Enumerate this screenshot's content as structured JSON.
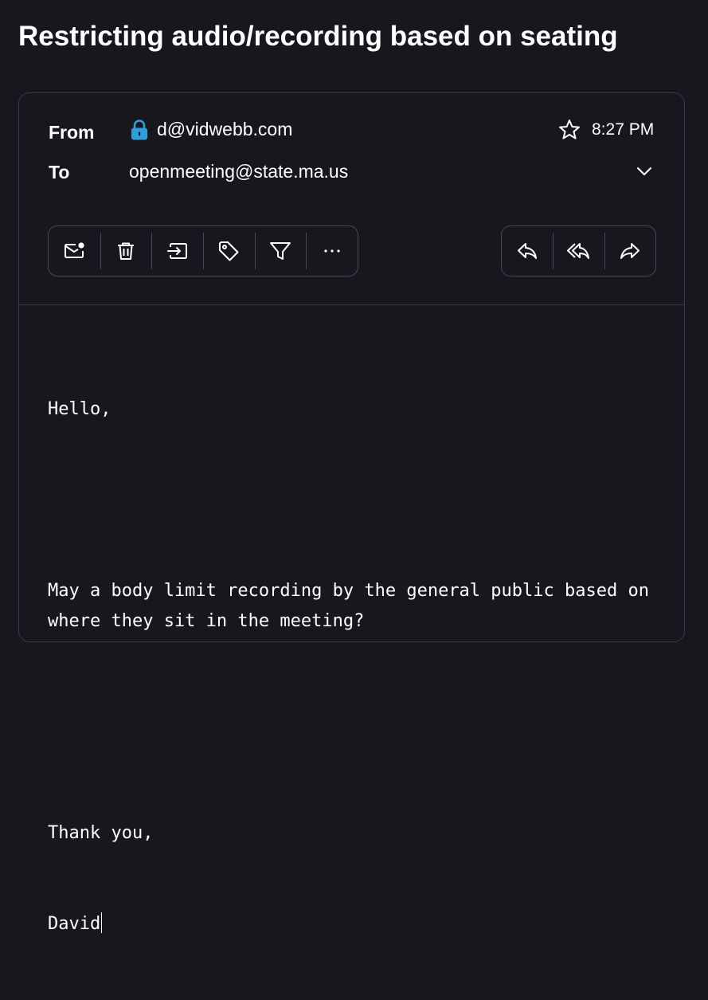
{
  "subject": "Restricting audio/recording based on seating",
  "header": {
    "from_label": "From",
    "from_address": "d@vidwebb.com",
    "to_label": "To",
    "to_address": "openmeeting@state.ma.us",
    "time": "8:27 PM",
    "lock_icon_color": "#2f9ed9"
  },
  "toolbar": {
    "left": [
      {
        "name": "mark-unread",
        "icon": "envelope-dot-icon"
      },
      {
        "name": "delete",
        "icon": "trash-icon"
      },
      {
        "name": "move",
        "icon": "move-to-folder-icon"
      },
      {
        "name": "tag",
        "icon": "tag-icon"
      },
      {
        "name": "filter",
        "icon": "filter-icon"
      },
      {
        "name": "more",
        "icon": "more-horizontal-icon"
      }
    ],
    "right": [
      {
        "name": "reply",
        "icon": "reply-icon"
      },
      {
        "name": "reply-all",
        "icon": "reply-all-icon"
      },
      {
        "name": "forward",
        "icon": "forward-icon"
      }
    ]
  },
  "body": {
    "greeting": "Hello,",
    "paragraph": "May a body limit recording by the general public based on where they sit in the meeting?",
    "closing": "Thank you,",
    "signature": "David"
  }
}
